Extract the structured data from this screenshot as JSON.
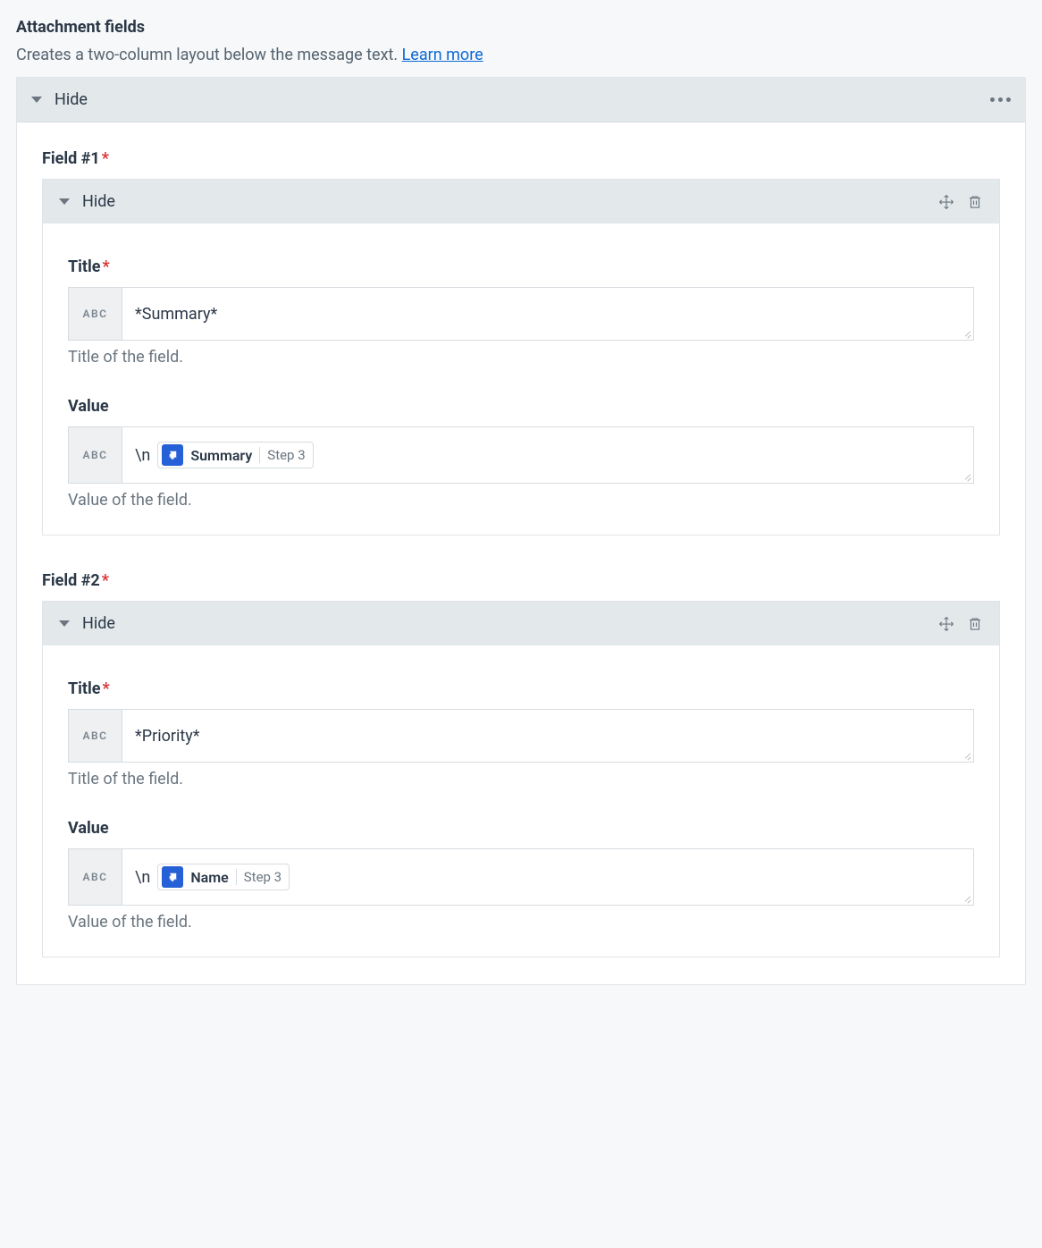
{
  "section": {
    "title": "Attachment fields",
    "description": "Creates a two-column layout below the message text. ",
    "learn_more": "Learn more"
  },
  "main_panel": {
    "toggle_label": "Hide"
  },
  "input_prefix": "ABC",
  "fields": [
    {
      "heading": "Field #1",
      "toggle_label": "Hide",
      "title": {
        "label": "Title",
        "value": "*Summary*",
        "help": "Title of the field."
      },
      "value": {
        "label": "Value",
        "prefix_text": "\\n",
        "token_name": "Summary",
        "token_step": "Step 3",
        "help": "Value of the field."
      }
    },
    {
      "heading": "Field #2",
      "toggle_label": "Hide",
      "title": {
        "label": "Title",
        "value": "*Priority*",
        "help": "Title of the field."
      },
      "value": {
        "label": "Value",
        "prefix_text": "\\n",
        "token_name": "Name",
        "token_step": "Step 3",
        "help": "Value of the field."
      }
    }
  ]
}
